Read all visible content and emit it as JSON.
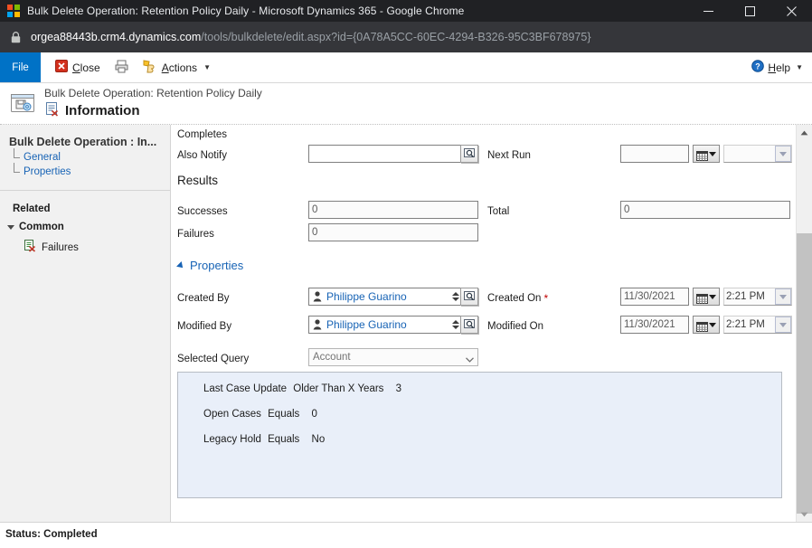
{
  "browser": {
    "window_title": "Bulk Delete Operation: Retention Policy Daily - Microsoft Dynamics 365 - Google Chrome",
    "url_host": "orgea88443b.crm4.dynamics.com",
    "url_path": "/tools/bulkdelete/edit.aspx?id={0A78A5CC-60EC-4294-B326-95C3BF678975}",
    "minimize_label": "Minimize",
    "maximize_label": "Maximize",
    "close_label": "Close"
  },
  "commandbar": {
    "file_label": "File",
    "close_label": "Close",
    "print_label": "Print",
    "actions_label": "Actions",
    "help_label": "Help"
  },
  "entity_header": {
    "subtitle": "Bulk Delete Operation: Retention Policy Daily",
    "title": "Information"
  },
  "navpane": {
    "entity_name": "Bulk Delete Operation : In...",
    "sub_items": [
      {
        "label": "General"
      },
      {
        "label": "Properties"
      }
    ],
    "related_label": "Related",
    "common_label": "Common",
    "common_items": [
      {
        "label": "Failures"
      }
    ]
  },
  "form": {
    "completes_label": "Completes",
    "also_notify": {
      "label": "Also Notify",
      "value": ""
    },
    "next_run": {
      "label": "Next Run",
      "date_value": "",
      "time_value": ""
    },
    "results_section": "Results",
    "successes": {
      "label": "Successes",
      "value": "0"
    },
    "failures": {
      "label": "Failures",
      "value": "0"
    },
    "total": {
      "label": "Total",
      "value": "0"
    },
    "properties_section": "Properties",
    "created_by": {
      "label": "Created By",
      "value": "Philippe Guarino"
    },
    "modified_by": {
      "label": "Modified By",
      "value": "Philippe Guarino"
    },
    "created_on": {
      "label": "Created On",
      "required_marker": "*",
      "date_value": "11/30/2021",
      "time_value": "2:21 PM"
    },
    "modified_on": {
      "label": "Modified On",
      "date_value": "11/30/2021",
      "time_value": "2:21 PM"
    },
    "selected_query": {
      "label": "Selected Query",
      "value": "Account"
    },
    "criteria": [
      {
        "attribute": "Last Case Update",
        "operator": "Older Than X Years",
        "value": "3"
      },
      {
        "attribute": "Open Cases",
        "operator": "Equals",
        "value": "0"
      },
      {
        "attribute": "Legacy Hold",
        "operator": "Equals",
        "value": "No"
      }
    ]
  },
  "statusbar": {
    "text": "Status: Completed"
  },
  "colors": {
    "accent_blue": "#0072c6",
    "link_blue": "#1763b5",
    "criteria_bg": "#e9eff9",
    "nav_bg": "#f1f1f1",
    "chrome_title_bg": "#202124",
    "chrome_url_bg": "#35363a"
  }
}
